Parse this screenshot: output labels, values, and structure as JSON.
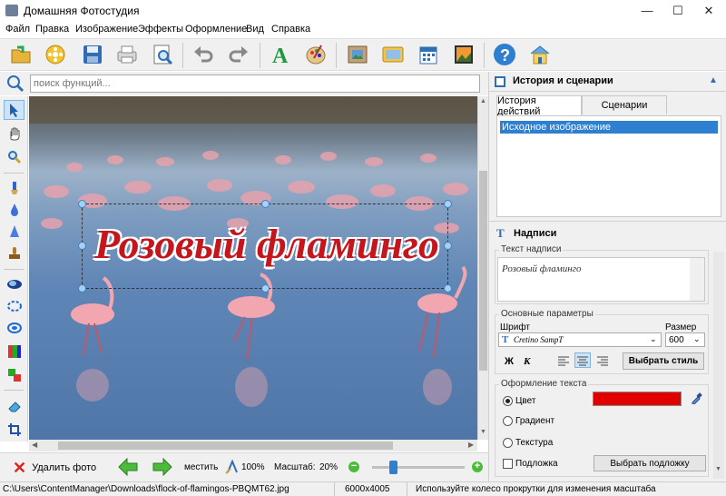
{
  "window": {
    "title": "Домашняя Фотостудия",
    "min": "—",
    "max": "☐",
    "close": "✕"
  },
  "menu": [
    "Файл",
    "Правка",
    "Изображение",
    "Эффекты",
    "Оформление",
    "Вид",
    "Справка"
  ],
  "toolbar": {
    "icons": [
      "open-folder-icon",
      "film-reel-icon",
      "save-disk-icon",
      "print-icon",
      "preview-zoom-icon",
      "undo-icon",
      "redo-icon",
      "text-A-icon",
      "palette-icon",
      "frame-icon",
      "postcard-icon",
      "calendar-icon",
      "collage-icon",
      "help-icon",
      "home-icon"
    ],
    "colors": {
      "text_A": "#1e9a3c",
      "help": "#2f7fd1"
    }
  },
  "search": {
    "placeholder": "поиск функций..."
  },
  "canvas": {
    "caption": "Розовый фламинго",
    "caption_color": "#c4161c"
  },
  "bottombar": {
    "delete_label": "Удалить фото",
    "fit_label": "местить",
    "zoom100_label": "100%",
    "scale_label": "Масштаб:",
    "scale_value": "20%",
    "zoom_slider_level": 0.2
  },
  "status": {
    "path": "C:\\Users\\ContentManager\\Downloads\\flock-of-flamingos-PBQMT62.jpg",
    "dimensions": "6000x4005",
    "hint": "Используйте колесо прокрутки для изменения масштаба"
  },
  "history_panel": {
    "title": "История и сценарии",
    "tabs": [
      "История действий",
      "Сценарии"
    ],
    "items": [
      "Исходное изображение"
    ]
  },
  "captions_panel": {
    "title": "Надписи",
    "text_group": "Текст надписи",
    "text_value": "Розовый фламинго",
    "params_group": "Основные параметры",
    "font_label": "Шрифт",
    "font_value": "Cretino SampT",
    "size_label": "Размер",
    "size_value": "600",
    "bold": "Ж",
    "italic": "К",
    "style_button": "Выбрать стиль",
    "design_group": "Оформление текста",
    "opt_color": "Цвет",
    "opt_gradient": "Градиент",
    "opt_texture": "Текстура",
    "color_value": "#e00000",
    "opt_backing": "Подложка",
    "backing_button": "Выбрать подложку"
  }
}
